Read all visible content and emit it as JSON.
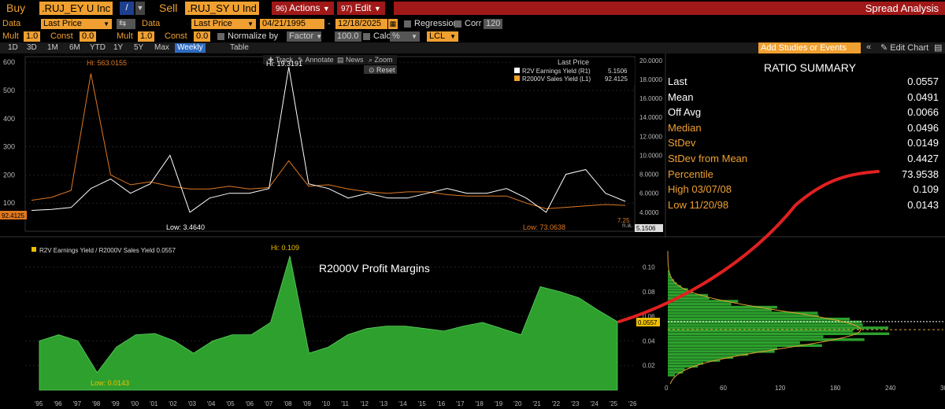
{
  "toolbar": {
    "buy_label": "Buy",
    "buy_ticker": ".RUJ_EY U Inc",
    "sell_label": "Sell",
    "sell_ticker": ".RUJ_SY U Ind",
    "actions_num": "96)",
    "actions_label": "Actions",
    "edit_num": "97)",
    "edit_label": "Edit",
    "title": "Spread Analysis"
  },
  "params": {
    "data_label": "Data",
    "data1_value": "Last Price",
    "data2_label": "Data",
    "data2_value": "Last Price",
    "start_date": "04/21/1995",
    "end_date": "12/18/2025",
    "regression_label": "Regression",
    "corr_label": "Corr",
    "corr_value": "120",
    "mult_label": "Mult",
    "mult_value": "1.0",
    "const_label": "Const",
    "const_value": "0.0",
    "mult2_label": "Mult",
    "mult2_value": "1.0",
    "const2_label": "Const",
    "const2_value": "0.0",
    "normalize_label": "Normalize by",
    "normalize_value": "Factor",
    "normalize_num": "100.0",
    "calc_label": "Calc",
    "calc_value": "%",
    "lcl_value": "LCL"
  },
  "tabs": [
    "1D",
    "3D",
    "1M",
    "6M",
    "YTD",
    "1Y",
    "5Y",
    "Max",
    "Weekly",
    "Table"
  ],
  "active_tab": "Weekly",
  "add_studies_placeholder": "Add Studies or Events",
  "edit_chart_label": "Edit Chart",
  "chart_tools": [
    "Track",
    "Annotate",
    "News",
    "Zoom"
  ],
  "reset_label": "Reset",
  "legend": {
    "title": "Last Price",
    "r2v_label": "R2V Earnings Yield  (R1)",
    "r2v_value": "5.1506",
    "r2000v_label": "R2000V Sales Yield  (L1)",
    "r2000v_value": "92.4125"
  },
  "top_annotations": {
    "hi_orange": "Hi: 563.0155",
    "hi_white": "Hi: 19.3191",
    "low_white": "Low: 3.4640",
    "low_orange": "Low: 73.0638",
    "left_tag": "92.4125",
    "right_tag": "5.1506",
    "na_tag": "n.a.",
    "pct_tag": "7.25"
  },
  "bottom": {
    "legend": "R2V Earnings Yield / R2000V Sales Yield 0.0557",
    "title": "R2000V Profit Margins",
    "hi": "Hi: 0.109",
    "low": "Low: 0.0143",
    "last_tag": "0.0557"
  },
  "summary": {
    "title": "RATIO SUMMARY",
    "rows": [
      {
        "label": "Last",
        "value": "0.0557",
        "color": "#ffffff"
      },
      {
        "label": "Mean",
        "value": "0.0491",
        "color": "#ffffff"
      },
      {
        "label": "Off Avg",
        "value": "0.0066",
        "color": "#ffffff"
      },
      {
        "label": "Median",
        "value": "0.0496",
        "color": "#f0a030"
      },
      {
        "label": "StDev",
        "value": "0.0149",
        "color": "#f0a030"
      },
      {
        "label": "StDev from Mean",
        "value": "0.4427",
        "color": "#f0a030"
      },
      {
        "label": "Percentile",
        "value": "73.9538",
        "color": "#f0a030"
      },
      {
        "label": "High 03/07/08",
        "value": "0.109",
        "color": "#f0a030"
      },
      {
        "label": "Low 11/20/98",
        "value": "0.0143",
        "color": "#f0a030"
      }
    ]
  },
  "chart_data": [
    {
      "type": "line",
      "x": [
        "'95",
        "'96",
        "'97",
        "'98",
        "'99",
        "'00",
        "'01",
        "'02",
        "'03",
        "'04",
        "'05",
        "'06",
        "'07",
        "'08",
        "'09",
        "'10",
        "'11",
        "'12",
        "'13",
        "'14",
        "'15",
        "'16",
        "'17",
        "'18",
        "'19",
        "'20",
        "'21",
        "'22",
        "'23",
        "'24",
        "'25",
        "'26"
      ],
      "left_axis": {
        "ticks": [
          100,
          200,
          300,
          400,
          500,
          600
        ],
        "ylim": [
          0,
          620
        ]
      },
      "right_axis": {
        "ticks": [
          "4.0000",
          "6.0000",
          "8.0000",
          "10.0000",
          "12.0000",
          "14.0000",
          "16.0000",
          "18.0000",
          "20.0000"
        ],
        "ylim": [
          2,
          20.4
        ]
      },
      "series": [
        {
          "name": "R2000V Sales Yield  (L1)",
          "axis": "left",
          "color": "#e07820",
          "values": [
            110,
            120,
            145,
            560,
            200,
            165,
            175,
            160,
            150,
            150,
            160,
            150,
            155,
            250,
            160,
            165,
            150,
            140,
            135,
            140,
            140,
            130,
            125,
            125,
            125,
            100,
            80,
            85,
            90,
            95,
            92
          ]
        },
        {
          "name": "R2V Earnings Yield  (R1)",
          "axis": "right",
          "color": "#ffffff",
          "values": [
            4.2,
            4.3,
            4.5,
            6.5,
            7.5,
            6,
            7,
            10,
            4,
            5.5,
            6,
            6,
            6.5,
            19.3,
            7,
            6.5,
            5.5,
            6,
            5.5,
            5.5,
            6,
            6.5,
            6,
            6,
            6.5,
            5.5,
            4,
            8,
            8.5,
            6,
            5.15
          ]
        }
      ]
    },
    {
      "type": "area",
      "x": [
        "'95",
        "'96",
        "'97",
        "'98",
        "'99",
        "'00",
        "'01",
        "'02",
        "'03",
        "'04",
        "'05",
        "'06",
        "'07",
        "'08",
        "'09",
        "'10",
        "'11",
        "'12",
        "'13",
        "'14",
        "'15",
        "'16",
        "'17",
        "'18",
        "'19",
        "'20",
        "'21",
        "'22",
        "'23",
        "'24",
        "'25",
        "'26"
      ],
      "ylim": [
        0,
        0.115
      ],
      "yticks": [
        "0.02",
        "0.04",
        "0.06",
        "0.08",
        "0.10"
      ],
      "series": [
        {
          "name": "R2V Earnings Yield / R2000V Sales Yield",
          "color": "#2da02d",
          "values": [
            0.04,
            0.045,
            0.04,
            0.0143,
            0.035,
            0.045,
            0.046,
            0.04,
            0.03,
            0.04,
            0.045,
            0.045,
            0.055,
            0.109,
            0.03,
            0.035,
            0.045,
            0.05,
            0.052,
            0.052,
            0.05,
            0.048,
            0.052,
            0.055,
            0.05,
            0.045,
            0.084,
            0.08,
            0.075,
            0.065,
            0.0557
          ]
        }
      ],
      "histogram": {
        "xticks": [
          "0",
          "60",
          "120",
          "180",
          "240",
          "300"
        ],
        "xlim": [
          0,
          300
        ]
      }
    }
  ],
  "colors": {
    "orange": "#f0a030",
    "red_line": "#e02020",
    "green": "#2da02d",
    "brand_red": "#a01818"
  }
}
